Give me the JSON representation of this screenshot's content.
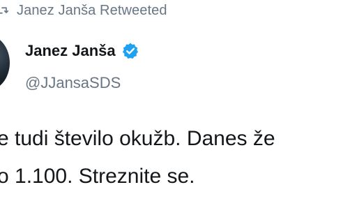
{
  "retweet": {
    "label": "Janez Janša Retweeted",
    "icon": "retweet-icon"
  },
  "author": {
    "display_name": "Janez Janša",
    "handle": "@JJansaSDS",
    "verified": true,
    "verified_icon": "verified-badge-icon",
    "verified_color": "#1DA1F2"
  },
  "tweet": {
    "lines": [
      "e tudi število okužb. Danes že",
      "o 1.100. Streznite se."
    ]
  },
  "colors": {
    "text_primary": "#14171A",
    "text_secondary": "#687684"
  }
}
